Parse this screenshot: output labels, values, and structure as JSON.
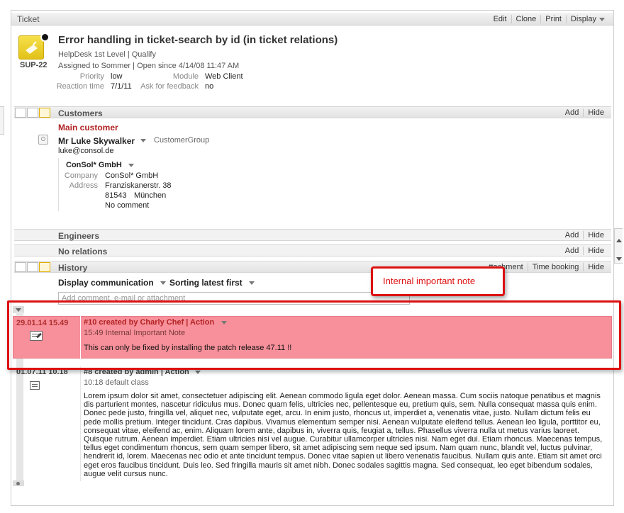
{
  "ticket": {
    "header_title": "Ticket",
    "actions": {
      "edit": "Edit",
      "clone": "Clone",
      "print": "Print",
      "display": "Display"
    },
    "id": "SUP-22",
    "title": "Error handling in ticket-search by id (in ticket relations)",
    "queue_line": "HelpDesk 1st Level | Qualify",
    "assigned_line": "Assigned to Sommer | Open since 4/14/08 11:47 AM",
    "fields": {
      "priority_label": "Priority",
      "priority_value": "low",
      "module_label": "Module",
      "module_value": "Web Client",
      "reaction_label": "Reaction time",
      "reaction_value": "7/1/11",
      "feedback_label": "Ask for feedback",
      "feedback_value": "no"
    }
  },
  "customers": {
    "title": "Customers",
    "add": "Add",
    "hide": "Hide",
    "main_label": "Main customer",
    "name": "Mr Luke Skywalker",
    "group": "CustomerGroup",
    "email": "luke@consol.de",
    "company_name": "ConSol* GmbH",
    "company_label": "Company",
    "company_value": "ConSol* GmbH",
    "address_label": "Address",
    "address_street": "Franziskanerstr. 38",
    "address_zip": "81543",
    "address_city": "München",
    "comment": "No comment"
  },
  "engineers": {
    "title": "Engineers",
    "add": "Add",
    "hide": "Hide"
  },
  "relations": {
    "title": "No relations",
    "add": "Add",
    "hide": "Hide"
  },
  "history": {
    "title": "History",
    "attachment": "ttachment",
    "time_booking": "Time booking",
    "hide": "Hide",
    "display_communication": "Display communication",
    "sorting": "Sorting latest first",
    "comment_placeholder": "Add comment, e-mail or attachment",
    "callout": "Internal important note",
    "entries": [
      {
        "date": "29.01.14 15.49",
        "title": "#10 created by Charly Chef | Action",
        "sub": "15:49 Internal Important Note",
        "text": "This can only be fixed by installing the patch release 47.11  !!"
      },
      {
        "date": "01.07.11 10.18",
        "title": "#8 created by admin | Action",
        "sub": "10:18 default class",
        "text": "Lorem ipsum dolor sit amet, consectetuer adipiscing elit. Aenean commodo ligula eget dolor. Aenean massa. Cum sociis natoque penatibus et magnis dis parturient montes, nascetur ridiculus mus. Donec quam felis, ultricies nec, pellentesque eu, pretium quis, sem. Nulla consequat massa quis enim. Donec pede justo, fringilla vel, aliquet nec, vulputate eget, arcu. In enim justo, rhoncus ut, imperdiet a, venenatis vitae, justo. Nullam dictum felis eu pede mollis pretium. Integer tincidunt. Cras dapibus. Vivamus elementum semper nisi. Aenean vulputate eleifend tellus. Aenean leo ligula, porttitor eu, consequat vitae, eleifend ac, enim. Aliquam lorem ante, dapibus in, viverra quis, feugiat a, tellus. Phasellus viverra nulla ut metus varius laoreet. Quisque rutrum. Aenean imperdiet. Etiam ultricies nisi vel augue. Curabitur ullamcorper ultricies nisi. Nam eget dui. Etiam rhoncus. Maecenas tempus, tellus eget condimentum rhoncus, sem quam semper libero, sit amet adipiscing sem neque sed ipsum. Nam quam nunc, blandit vel, luctus pulvinar, hendrerit id, lorem. Maecenas nec odio et ante tincidunt tempus. Donec vitae sapien ut libero venenatis faucibus. Nullam quis ante. Etiam sit amet orci eget eros faucibus tincidunt. Duis leo. Sed fringilla mauris sit amet nibh. Donec sodales sagittis magna. Sed consequat, leo eget bibendum sodales, augue velit cursus nunc."
      }
    ]
  },
  "colors": {
    "accent_red": "#dd1111",
    "highlight_pink": "#f7909a",
    "main_customer": "#b22222",
    "entry_title": "#b22222"
  }
}
